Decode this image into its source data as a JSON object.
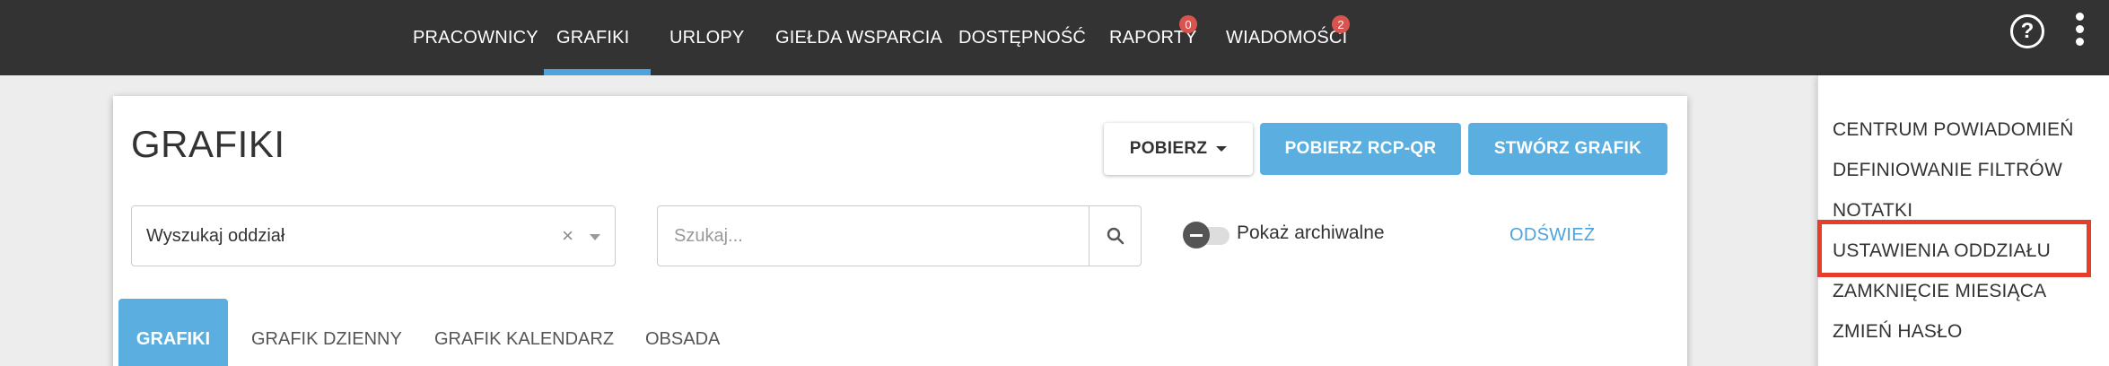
{
  "nav": {
    "items": [
      {
        "label": "PRACOWNICY"
      },
      {
        "label": "GRAFIKI",
        "active": true
      },
      {
        "label": "URLOPY"
      },
      {
        "label": "GIEŁDA WSPARCIA"
      },
      {
        "label": "DOSTĘPNOŚĆ"
      },
      {
        "label": "RAPORTY",
        "badge": "0"
      },
      {
        "label": "WIADOMOŚCI",
        "badge": "2"
      }
    ],
    "help_icon": "?",
    "accent": "#4da3dc"
  },
  "page": {
    "title": "GRAFIKI",
    "buttons": {
      "download": "POBIERZ",
      "download_rcp": "POBIERZ RCP-QR",
      "create": "STWÓRZ GRAFIK"
    },
    "department_select": {
      "value": "Wyszukaj oddział",
      "clear": "×"
    },
    "search": {
      "placeholder": "Szukaj..."
    },
    "archive_toggle": {
      "label": "Pokaż archiwalne",
      "on": false
    },
    "refresh": "ODŚWIEŻ",
    "tabs": [
      {
        "label": "GRAFIKI",
        "active": true
      },
      {
        "label": "GRAFIK DZIENNY"
      },
      {
        "label": "GRAFIK KALENDARZ"
      },
      {
        "label": "OBSADA"
      }
    ]
  },
  "menu": {
    "items": [
      {
        "label": "CENTRUM POWIADOMIEŃ"
      },
      {
        "label": "DEFINIOWANIE FILTRÓW"
      },
      {
        "label": "NOTATKI"
      },
      {
        "label": "USTAWIENIA ODDZIAŁU",
        "highlighted": true
      },
      {
        "label": "ZAMKNIĘCIE MIESIĄCA"
      },
      {
        "label": "ZMIEŃ HASŁO"
      }
    ],
    "highlight_color": "#e53e2b"
  },
  "colors": {
    "topbar": "#333333",
    "primary": "#5aafe0",
    "badge": "#d9534f"
  }
}
